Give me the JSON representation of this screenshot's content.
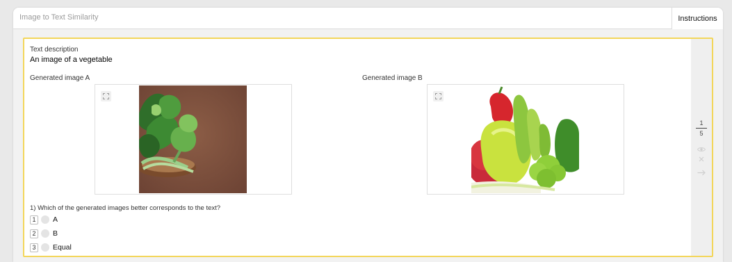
{
  "header": {
    "title": "Image to Text Similarity",
    "instructions_label": "Instructions"
  },
  "task": {
    "text_description_label": "Text description",
    "text_description_value": "An image of a vegetable",
    "image_a_label": "Generated image A",
    "image_b_label": "Generated image B",
    "question": "1) Which of the generated images better corresponds to the text?",
    "options": [
      {
        "key": "1",
        "label": "A"
      },
      {
        "key": "2",
        "label": "B"
      },
      {
        "key": "3",
        "label": "Equal"
      }
    ]
  },
  "pager": {
    "current": "1",
    "total": "5"
  },
  "icons": {
    "expand": "expand-icon",
    "visibility": "eye-icon",
    "skip": "close-icon",
    "next": "arrow-right-icon"
  },
  "colors": {
    "task_border": "#f3d65a",
    "side_panel": "#efefef",
    "radio": "#e4e4e4"
  }
}
